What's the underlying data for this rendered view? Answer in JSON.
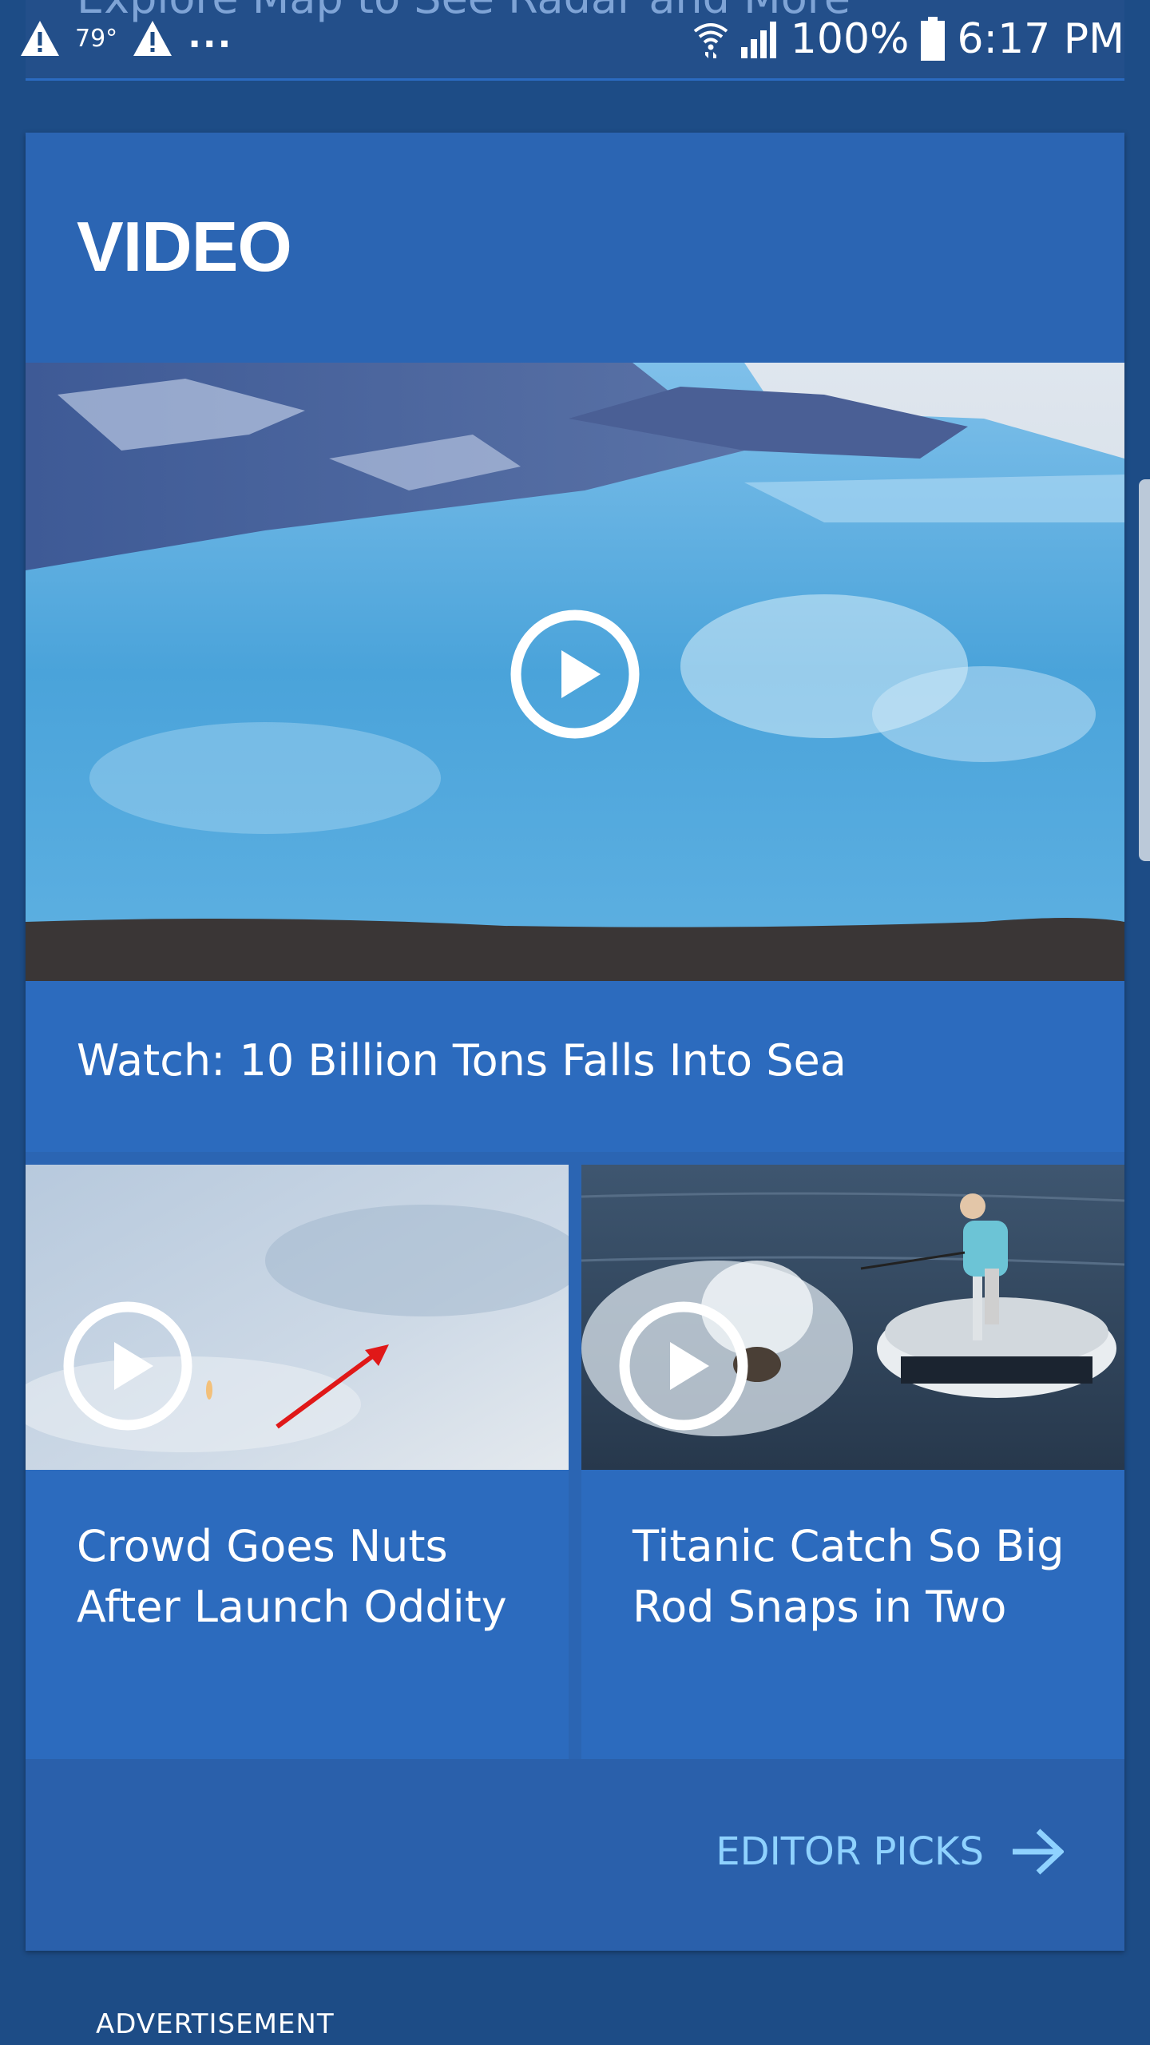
{
  "status_bar": {
    "temperature": "79°",
    "ellipsis": "...",
    "battery_percent": "100%",
    "time": "6:17 PM"
  },
  "peek_card": {
    "text": "Explore Map to See Radar and More"
  },
  "video_section": {
    "title": "VIDEO",
    "hero": {
      "title": "Watch: 10 Billion Tons Falls Into Sea"
    },
    "items": [
      {
        "title": "Crowd Goes Nuts After Launch Oddity"
      },
      {
        "title": "Titanic Catch So Big Rod Snaps in Two"
      }
    ],
    "editor_picks_label": "EDITOR PICKS"
  },
  "advertisement_label": "ADVERTISEMENT",
  "colors": {
    "background": "#1d4c86",
    "card": "#2b65b3",
    "link": "#8fd2ff"
  }
}
